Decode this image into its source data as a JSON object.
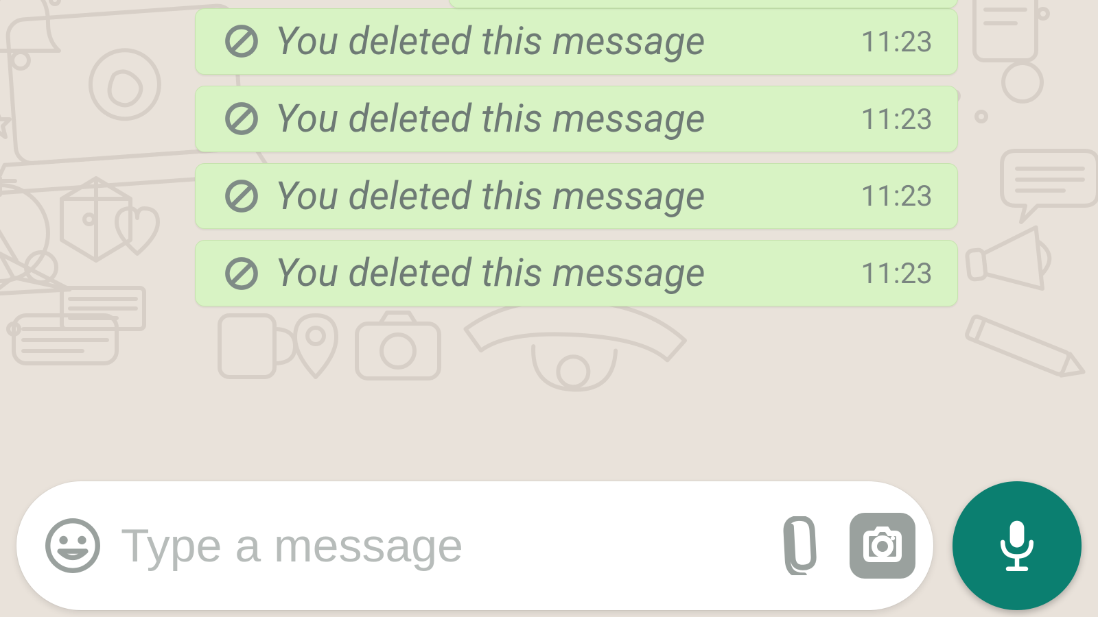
{
  "colors": {
    "bubble_bg": "#d8f3c4",
    "bubble_border": "#c6e3ae",
    "deleted_text": "#6e7a75",
    "timestamp": "#7a8580",
    "placeholder": "#b7bcba",
    "wallpaper_bg": "#e9e2da",
    "wallpaper_ink": "#c9c1b8",
    "icon_grey": "#9aa19e",
    "mic_bg": "#0b7f70"
  },
  "chat": {
    "messages": [
      {
        "deleted": true,
        "text": "You deleted this message",
        "time": "11:23"
      },
      {
        "deleted": true,
        "text": "You deleted this message",
        "time": "11:23"
      },
      {
        "deleted": true,
        "text": "You deleted this message",
        "time": "11:23"
      },
      {
        "deleted": true,
        "text": "You deleted this message",
        "time": "11:23"
      }
    ]
  },
  "composer": {
    "placeholder": "Type a message",
    "value": ""
  },
  "icons": {
    "emoji": "emoji-icon",
    "attach": "attach-icon",
    "camera": "camera-icon",
    "mic": "mic-icon",
    "deleted": "prohibited-icon"
  }
}
